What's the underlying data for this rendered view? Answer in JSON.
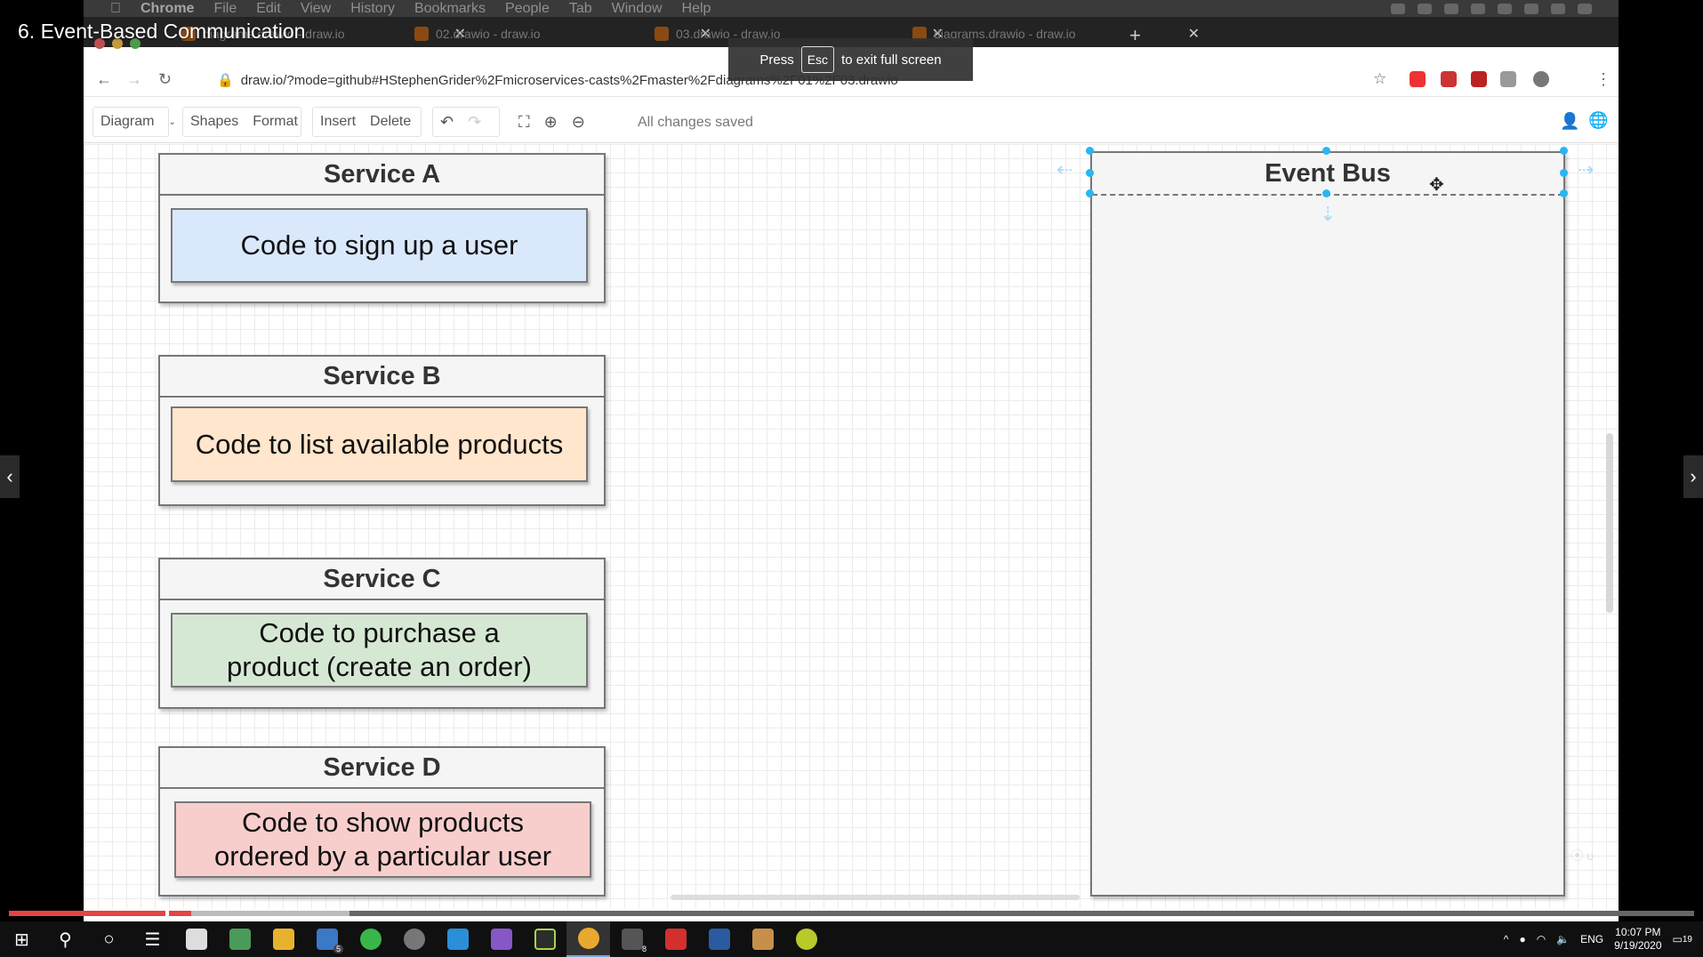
{
  "video": {
    "title": "6. Event-Based Communication",
    "progress_fraction": 0.108
  },
  "menubar": {
    "items": [
      "Chrome",
      "File",
      "Edit",
      "View",
      "History",
      "Bookmarks",
      "People",
      "Tab",
      "Window",
      "Help"
    ]
  },
  "tabs": [
    {
      "label": "diagrams.drawio - draw.io"
    },
    {
      "label": "02.drawio - draw.io"
    },
    {
      "label": "03.drawio - draw.io"
    },
    {
      "label": "diagrams.drawio - draw.io"
    }
  ],
  "address_bar": {
    "url": "draw.io/?mode=github#HStephenGrider%2Fmicroservices-casts%2Fmaster%2Fdiagrams%2F01%2F03.drawio"
  },
  "fullscreen_toast": {
    "prefix": "Press",
    "key": "Esc",
    "suffix": "to exit full screen"
  },
  "toolbar": {
    "diagram_label": "Diagram",
    "shapes_label": "Shapes",
    "format_label": "Format",
    "insert_label": "Insert",
    "delete_label": "Delete",
    "status": "All changes saved"
  },
  "diagram": {
    "services": [
      {
        "title": "Service A",
        "code": "Code to sign up a user",
        "fill": "#dae8fc"
      },
      {
        "title": "Service B",
        "code": "Code to list available products",
        "fill": "#ffe6cc"
      },
      {
        "title": "Service C",
        "code": "Code to purchase a product (create an order)",
        "fill": "#d5e8d4"
      },
      {
        "title": "Service D",
        "code": "Code to show products ordered by a particular user",
        "fill": "#f8cecc"
      }
    ],
    "event_bus": {
      "title": "Event Bus"
    }
  },
  "taskbar": {
    "mail_badge": "5",
    "app8_badge": "8",
    "language": "ENG",
    "time": "10:07 PM",
    "date": "9/19/2020",
    "notifications": "19"
  }
}
